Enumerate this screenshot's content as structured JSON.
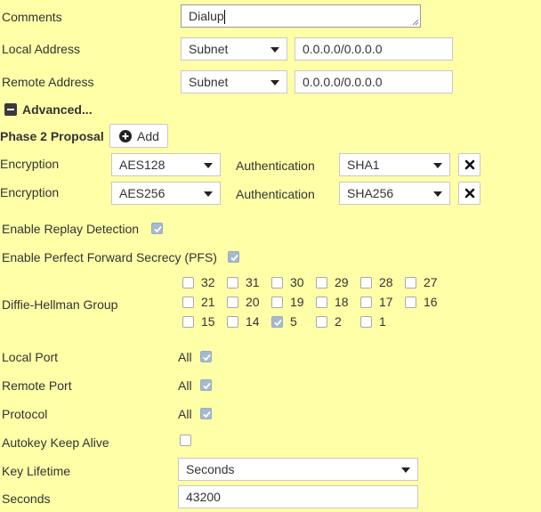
{
  "comments": {
    "label": "Comments",
    "value": "Dialup"
  },
  "local_address": {
    "label": "Local Address",
    "type": "Subnet",
    "value": "0.0.0.0/0.0.0.0"
  },
  "remote_address": {
    "label": "Remote Address",
    "type": "Subnet",
    "value": "0.0.0.0/0.0.0.0"
  },
  "advanced": {
    "label": "Advanced..."
  },
  "phase2": {
    "label": "Phase 2 Proposal",
    "add_label": "Add",
    "rows": [
      {
        "enc_label": "Encryption",
        "encryption": "AES128",
        "auth_label": "Authentication",
        "authentication": "SHA1"
      },
      {
        "enc_label": "Encryption",
        "encryption": "AES256",
        "auth_label": "Authentication",
        "authentication": "SHA256"
      }
    ]
  },
  "replay": {
    "label": "Enable Replay Detection",
    "checked": true
  },
  "pfs": {
    "label": "Enable Perfect Forward Secrecy (PFS)",
    "checked": true
  },
  "dh": {
    "label": "Diffie-Hellman Group",
    "groups": [
      {
        "value": "32",
        "checked": false
      },
      {
        "value": "31",
        "checked": false
      },
      {
        "value": "30",
        "checked": false
      },
      {
        "value": "29",
        "checked": false
      },
      {
        "value": "28",
        "checked": false
      },
      {
        "value": "27",
        "checked": false
      },
      {
        "value": "21",
        "checked": false
      },
      {
        "value": "20",
        "checked": false
      },
      {
        "value": "19",
        "checked": false
      },
      {
        "value": "18",
        "checked": false
      },
      {
        "value": "17",
        "checked": false
      },
      {
        "value": "16",
        "checked": false
      },
      {
        "value": "15",
        "checked": false
      },
      {
        "value": "14",
        "checked": false
      },
      {
        "value": "5",
        "checked": true
      },
      {
        "value": "2",
        "checked": false
      },
      {
        "value": "1",
        "checked": false
      }
    ]
  },
  "local_port": {
    "label": "Local Port",
    "value": "All",
    "checked": true
  },
  "remote_port": {
    "label": "Remote Port",
    "value": "All",
    "checked": true
  },
  "protocol": {
    "label": "Protocol",
    "value": "All",
    "checked": true
  },
  "autokey": {
    "label": "Autokey Keep Alive",
    "checked": false
  },
  "key_lifetime": {
    "label": "Key Lifetime",
    "value": "Seconds"
  },
  "seconds": {
    "label": "Seconds",
    "value": "43200"
  },
  "colors": {
    "background": "#ffffa8",
    "checkbox_checked": "#a5b9cf"
  },
  "icons": {
    "add": "plus-circle-icon",
    "remove": "x-icon",
    "advanced": "minus-square-icon",
    "check": "check-icon",
    "dropdown": "chevron-down-icon"
  }
}
